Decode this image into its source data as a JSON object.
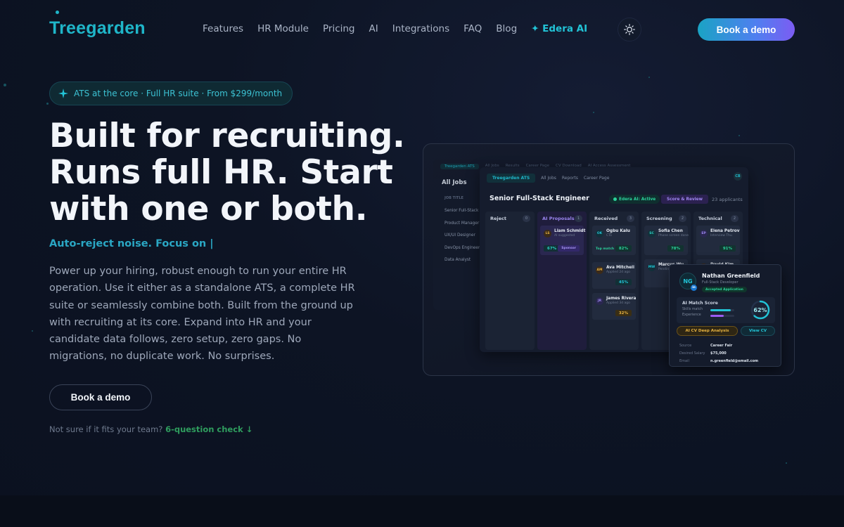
{
  "brand": {
    "logo": "Treegarden"
  },
  "nav": {
    "items": [
      "Features",
      "HR Module",
      "Pricing",
      "AI",
      "Integrations",
      "FAQ",
      "Blog"
    ],
    "edera_label": "✦ Edera AI",
    "theme_icon": "sun-icon",
    "cta": "Book a demo"
  },
  "hero": {
    "pill": "ATS at the core · Full HR suite · From $299/month",
    "headline": [
      "Built for recruiting.",
      "Runs full HR. Start",
      "with one or both."
    ],
    "typed": "Auto-reject noise. Focus on |",
    "paragraph": "Power up your hiring, robust enough to run your entire HR operation. Use it either as a standalone ATS, a complete HR suite or seamlessly combine both. Built from the ground up with recruiting at its core. Expand into HR and your candidate data follows, zero setup, zero gaps. No migrations, no duplicate work. No surprises.",
    "cta": "Book a demo",
    "fit_prefix": "Not sure if it fits your team?",
    "fit_link": "6-question check ↓"
  },
  "mockup": {
    "back": {
      "tabs": [
        "Treegarden ATS",
        "All Jobs",
        "Results",
        "Career Page",
        "CV Download",
        "AI Access Assessment"
      ],
      "title": "All Jobs",
      "col_head": "JOB TITLE",
      "jobs": [
        "Senior Full-Stack Engineer",
        "Product Manager",
        "UX/UI Designer",
        "DevOps Engineer",
        "Data Analyst"
      ]
    },
    "main": {
      "tabs": [
        "Treegarden ATS",
        "All Jobs",
        "Reports",
        "Career Page"
      ],
      "avatar": "CB",
      "job_title": "Senior Full-Stack Engineer",
      "ai_badge": "Edera AI: Active",
      "score_btn": "Score & Review",
      "applicants": "23 applicants",
      "columns": [
        {
          "name": "Reject",
          "count": "0",
          "cards": []
        },
        {
          "name": "AI Proposals",
          "count": "1",
          "cards": [
            {
              "initials": "LS",
              "name": "Liam Schmidt",
              "sub": "AI suggested",
              "pct": "67%",
              "tag": "Sponsor"
            }
          ]
        },
        {
          "name": "Received",
          "count": "3",
          "cards": [
            {
              "initials": "OK",
              "name": "Ogbu Kalu",
              "sub": "CTo",
              "pct": "82%",
              "tag": "Top match"
            },
            {
              "initials": "AM",
              "name": "Ava Mitchell",
              "sub": "Applied 2d ago",
              "pct": "45%",
              "tag": ""
            },
            {
              "initials": "JR",
              "name": "James Rivera",
              "sub": "Applied 3d ago",
              "pct": "32%",
              "tag": ""
            }
          ]
        },
        {
          "name": "Screening",
          "count": "2",
          "cards": [
            {
              "initials": "SC",
              "name": "Sofia Chen",
              "sub": "Phone screen done",
              "pct": "78%",
              "tag": ""
            },
            {
              "initials": "MW",
              "name": "Marcus Wu",
              "sub": "Pending",
              "pct": "",
              "tag": ""
            }
          ]
        },
        {
          "name": "Technical",
          "count": "2",
          "cards": [
            {
              "initials": "EP",
              "name": "Elena Petrov",
              "sub": "Interview Thu",
              "pct": "91%",
              "tag": ""
            },
            {
              "initials": "DK",
              "name": "David Kim",
              "sub": "",
              "pct": "",
              "tag": ""
            }
          ]
        }
      ]
    },
    "profile": {
      "initials": "NG",
      "linkedin": "in",
      "name": "Nathan Greenfield",
      "role": "Full-Stack Developer",
      "status": "Accepted Application",
      "match_title": "AI Match Score",
      "skills_label": "Skills match",
      "experience_label": "Experience",
      "skills_value": 0.85,
      "experience_value": 0.55,
      "score": "62%",
      "score_value": 0.62,
      "btn_analysis": "AI CV Deep Analysis",
      "btn_view": "View CV",
      "fields": [
        {
          "k": "Source",
          "v": "Career Fair"
        },
        {
          "k": "Desired Salary",
          "v": "$75,000"
        },
        {
          "k": "Email",
          "v": "n.greenfield@email.com"
        }
      ]
    }
  },
  "colors": {
    "accent": "#1fb6c9",
    "cta_gradient": [
      "#1aa3c4",
      "#7c5cf2"
    ],
    "green": "#2bd19a",
    "purple": "#9b86f0",
    "gold": "#e7b341"
  }
}
